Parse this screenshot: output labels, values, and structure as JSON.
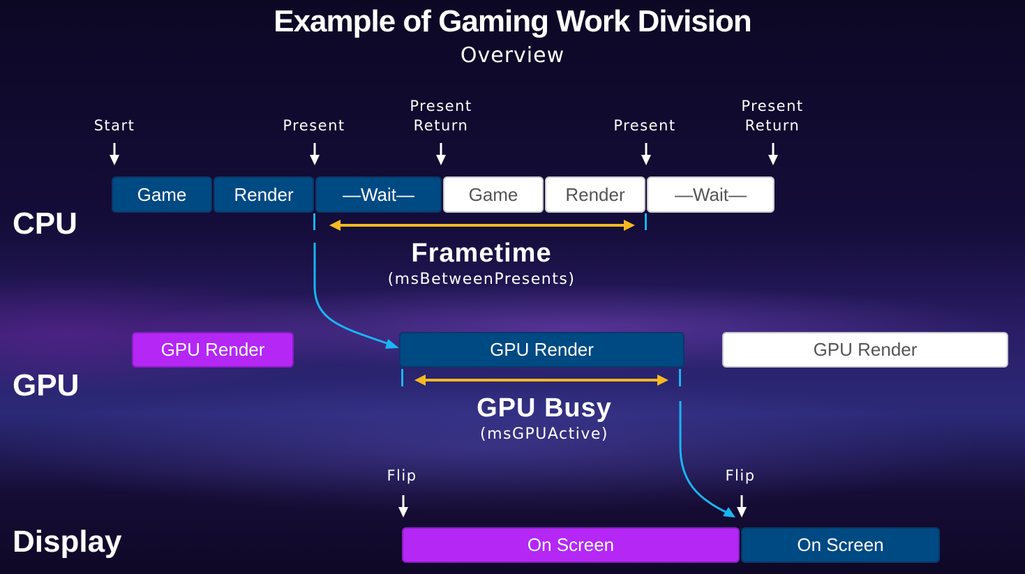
{
  "title": "Example of Gaming Work Division",
  "subtitle": "Overview",
  "lanes": {
    "cpu": "CPU",
    "gpu": "GPU",
    "display": "Display"
  },
  "cpu": {
    "markers": [
      "Start",
      "Present",
      "Present Return",
      "Present",
      "Present Return"
    ],
    "markers_split": [
      [
        "Start"
      ],
      [
        "Present"
      ],
      [
        "Present",
        "Return"
      ],
      [
        "Present"
      ],
      [
        "Present",
        "Return"
      ]
    ],
    "frame1": [
      "Game",
      "Render",
      "—Wait—"
    ],
    "frame2": [
      "Game",
      "Render",
      "—Wait—"
    ]
  },
  "frametime": {
    "label": "Frametime",
    "metric": "(msBetweenPresents)"
  },
  "gpu": {
    "boxes": [
      "GPU Render",
      "GPU Render",
      "GPU Render"
    ]
  },
  "gpu_busy": {
    "label": "GPU Busy",
    "metric": "(msGPUActive)"
  },
  "display": {
    "markers": [
      "Flip",
      "Flip"
    ],
    "boxes": [
      "On Screen",
      "On Screen"
    ]
  },
  "colors": {
    "frame_blue": "#004a84",
    "frame_white": "#ffffff",
    "frame_purple": "#b427f5",
    "connector_cyan": "#19b6f2",
    "span_arrow_yellow": "#f5b921"
  }
}
